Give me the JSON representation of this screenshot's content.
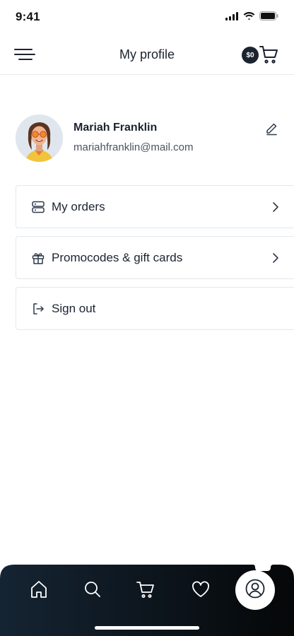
{
  "status_bar": {
    "time": "9:41",
    "icons": [
      "signal-icon",
      "wifi-icon",
      "battery-icon"
    ]
  },
  "header": {
    "title": "My profile",
    "menu_icon": "hamburger-menu-icon",
    "cart_badge": "$0",
    "cart_icon": "cart-icon"
  },
  "profile": {
    "name": "Mariah Franklin",
    "email": "mariahfranklin@mail.com",
    "edit_icon": "pencil-icon"
  },
  "menu": {
    "items": [
      {
        "label": "My orders",
        "icon": "orders-icon"
      },
      {
        "label": "Promocodes & gift cards",
        "icon": "gift-icon"
      },
      {
        "label": "Sign out",
        "icon": "sign-out-icon"
      }
    ]
  },
  "tab_bar": {
    "tabs": [
      {
        "name": "home",
        "icon": "home-icon"
      },
      {
        "name": "search",
        "icon": "search-icon"
      },
      {
        "name": "cart",
        "icon": "cart-icon"
      },
      {
        "name": "favorites",
        "icon": "heart-icon"
      },
      {
        "name": "profile",
        "icon": "user-icon",
        "active": true
      }
    ]
  },
  "colors": {
    "primary_dark": "#1b2330",
    "tab_bar_gradient_start": "#152433",
    "tab_bar_gradient_end": "#050708",
    "border": "#e3e7ed",
    "background": "#ffffff",
    "muted_text": "#4a5462"
  }
}
